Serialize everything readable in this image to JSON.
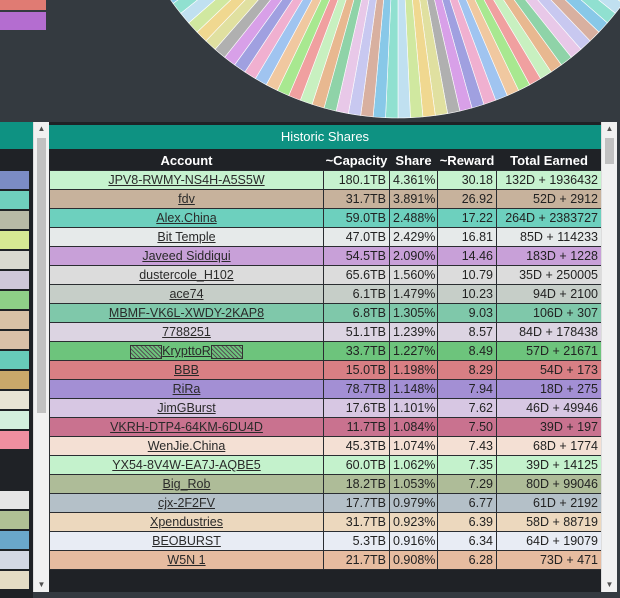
{
  "legend_swatches": [
    "#e07b73",
    "#b46dd0"
  ],
  "pie_palette": [
    "#8fd3a8",
    "#f0a0a0",
    "#a0c4f0",
    "#d8a0e8",
    "#f0d890",
    "#90e0d0",
    "#c8c8f0",
    "#e8b890",
    "#a8e890",
    "#f0b0d0",
    "#b0b0b0",
    "#d0e8a0",
    "#88c8e8",
    "#e8c8e8",
    "#c8f0c0",
    "#f0c8a0",
    "#a0a0e0",
    "#e0e0a0",
    "#c0e0f0",
    "#d8b0a0"
  ],
  "left_panel_colors": [
    "#7b8cc4",
    "#6fcfbd",
    "#b7b9a6",
    "#d6e993",
    "#d9d9cf",
    "#cfc8d9",
    "#8ecf87",
    "#d8c2a6",
    "#d9c0a8",
    "#67cbb9",
    "#c9a86a",
    "#e8e4d4",
    "#d4f0de",
    "#ef8fa0",
    "#e6e6e6",
    "#b0c094",
    "#6aa7c9",
    "#d4d8e4",
    "#e4dcc4"
  ],
  "table": {
    "title": "Historic Shares",
    "columns": [
      "Account",
      "~Capacity",
      "Share",
      "~Reward",
      "Total Earned"
    ],
    "rows": [
      {
        "account": "JPV8-RWMY-NS4H-A5S5W",
        "capacity": "180.1TB",
        "share": "4.361%",
        "reward": "30.18",
        "total": "132D + 1936432",
        "color": "#c6f2cf"
      },
      {
        "account": "fdv",
        "capacity": "31.7TB",
        "share": "3.891%",
        "reward": "26.92",
        "total": "52D + 2912",
        "color": "#c7b29c"
      },
      {
        "account": "Alex.China",
        "capacity": "59.0TB",
        "share": "2.488%",
        "reward": "17.22",
        "total": "264D + 2383727",
        "color": "#6dd0be"
      },
      {
        "account": "Bit Temple",
        "capacity": "47.0TB",
        "share": "2.429%",
        "reward": "16.81",
        "total": "85D + 114233",
        "color": "#e6eaea"
      },
      {
        "account": "Javeed Siddiqui",
        "capacity": "54.5TB",
        "share": "2.090%",
        "reward": "14.46",
        "total": "183D + 1228",
        "color": "#c8a0d8"
      },
      {
        "account": "dustercole_H102",
        "capacity": "65.6TB",
        "share": "1.560%",
        "reward": "10.79",
        "total": "35D + 250005",
        "color": "#dcdcdc"
      },
      {
        "account": "ace74",
        "capacity": "6.1TB",
        "share": "1.479%",
        "reward": "10.23",
        "total": "94D + 2100",
        "color": "#c6cec8"
      },
      {
        "account": "MBMF-VK6L-XWDY-2KAP8",
        "capacity": "6.8TB",
        "share": "1.305%",
        "reward": "9.03",
        "total": "106D + 307",
        "color": "#7fc8aa"
      },
      {
        "account": "7788251",
        "capacity": "51.1TB",
        "share": "1.239%",
        "reward": "8.57",
        "total": "84D + 178438",
        "color": "#dcd4e2"
      },
      {
        "account": "KrypttoR",
        "capacity": "33.7TB",
        "share": "1.227%",
        "reward": "8.49",
        "total": "57D + 21671",
        "color": "#6dc47c"
      },
      {
        "account": "BBB",
        "capacity": "15.0TB",
        "share": "1.198%",
        "reward": "8.29",
        "total": "54D + 173",
        "color": "#d87f84"
      },
      {
        "account": "RiRa",
        "capacity": "78.7TB",
        "share": "1.148%",
        "reward": "7.94",
        "total": "18D + 275",
        "color": "#a38fd4"
      },
      {
        "account": "JimGBurst",
        "capacity": "17.6TB",
        "share": "1.101%",
        "reward": "7.62",
        "total": "46D + 49946",
        "color": "#d7c7e3"
      },
      {
        "account": "VKRH-DTP4-64KM-6DU4D",
        "capacity": "11.7TB",
        "share": "1.084%",
        "reward": "7.50",
        "total": "39D + 197",
        "color": "#c9728f"
      },
      {
        "account": "WenJie.China",
        "capacity": "45.3TB",
        "share": "1.074%",
        "reward": "7.43",
        "total": "68D + 1774",
        "color": "#f4e0d4"
      },
      {
        "account": "YX54-8V4W-EA7J-AQBE5",
        "capacity": "60.0TB",
        "share": "1.062%",
        "reward": "7.35",
        "total": "39D + 14125",
        "color": "#c4f2cc"
      },
      {
        "account": "Big_Rob",
        "capacity": "18.2TB",
        "share": "1.053%",
        "reward": "7.29",
        "total": "80D + 99046",
        "color": "#aebc98"
      },
      {
        "account": "cjx-2F2FV",
        "capacity": "17.7TB",
        "share": "0.979%",
        "reward": "6.77",
        "total": "61D + 2192",
        "color": "#b4c0c8"
      },
      {
        "account": "Xpendustries",
        "capacity": "31.7TB",
        "share": "0.923%",
        "reward": "6.39",
        "total": "58D + 88719",
        "color": "#ecd8be"
      },
      {
        "account": "BEOBURST",
        "capacity": "5.3TB",
        "share": "0.916%",
        "reward": "6.34",
        "total": "64D + 19079",
        "color": "#e8ecf4"
      },
      {
        "account": "W5N 1",
        "capacity": "21.7TB",
        "share": "0.908%",
        "reward": "6.28",
        "total": "73D + 471",
        "color": "#e6bca0"
      }
    ]
  },
  "scrollbars": {
    "up_glyph": "▲",
    "down_glyph": "▼"
  }
}
